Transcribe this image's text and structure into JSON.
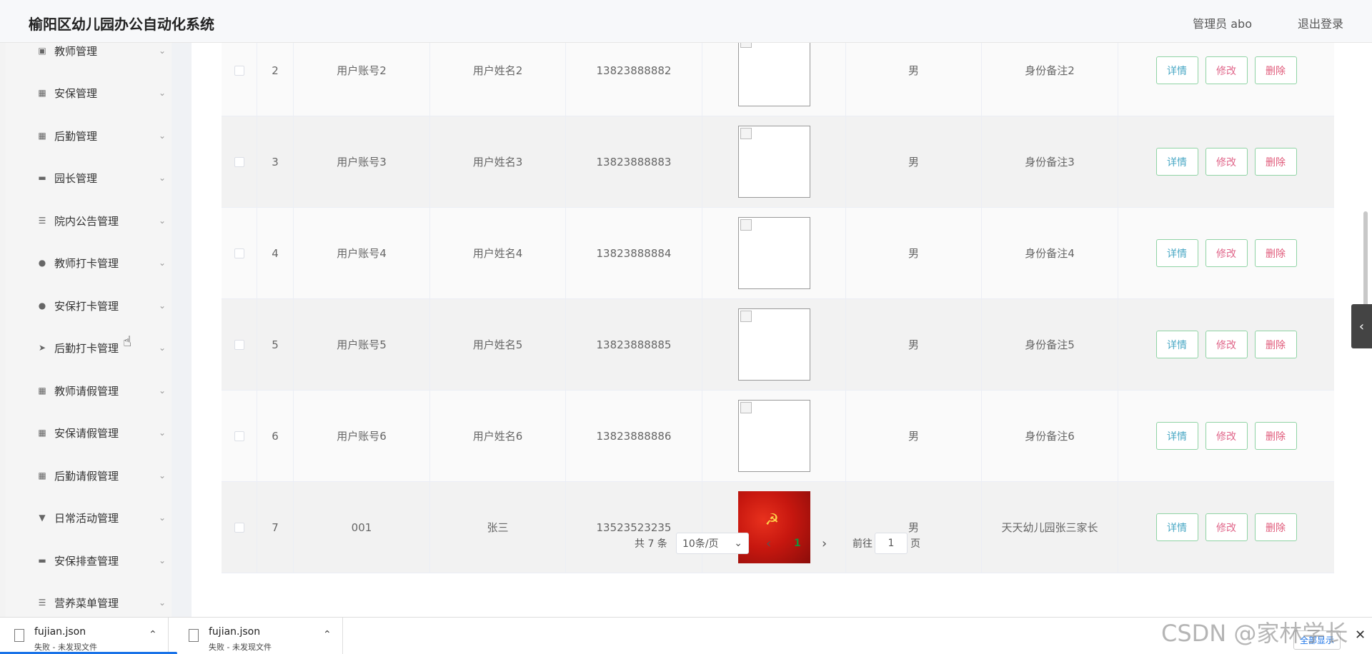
{
  "header": {
    "title": "榆阳区幼儿园办公自动化系统",
    "user": "管理员 abo",
    "logout": "退出登录"
  },
  "sidebar": {
    "items": [
      {
        "icon": "▣",
        "label": "教师管理",
        "chev": "⌄"
      },
      {
        "icon": "▦",
        "label": "安保管理",
        "chev": "⌄"
      },
      {
        "icon": "▦",
        "label": "后勤管理",
        "chev": "⌄"
      },
      {
        "icon": "▬",
        "label": "园长管理",
        "chev": "⌄"
      },
      {
        "icon": "☰",
        "label": "院内公告管理",
        "chev": "⌄"
      },
      {
        "icon": "●",
        "label": "教师打卡管理",
        "chev": "⌄"
      },
      {
        "icon": "●",
        "label": "安保打卡管理",
        "chev": "⌄"
      },
      {
        "icon": "➤",
        "label": "后勤打卡管理",
        "chev": "⌄"
      },
      {
        "icon": "▦",
        "label": "教师请假管理",
        "chev": "⌄"
      },
      {
        "icon": "▦",
        "label": "安保请假管理",
        "chev": "⌄"
      },
      {
        "icon": "▦",
        "label": "后勤请假管理",
        "chev": "⌄"
      },
      {
        "icon": "▼",
        "label": "日常活动管理",
        "chev": "⌄"
      },
      {
        "icon": "▬",
        "label": "安保排查管理",
        "chev": "⌄"
      },
      {
        "icon": "☰",
        "label": "营养菜单管理",
        "chev": "⌄"
      }
    ]
  },
  "table": {
    "rows": [
      {
        "index": "2",
        "account": "用户账号2",
        "name": "用户姓名2",
        "phone": "13823888882",
        "gender": "男",
        "note": "身份备注2"
      },
      {
        "index": "3",
        "account": "用户账号3",
        "name": "用户姓名3",
        "phone": "13823888883",
        "gender": "男",
        "note": "身份备注3"
      },
      {
        "index": "4",
        "account": "用户账号4",
        "name": "用户姓名4",
        "phone": "13823888884",
        "gender": "男",
        "note": "身份备注4"
      },
      {
        "index": "5",
        "account": "用户账号5",
        "name": "用户姓名5",
        "phone": "13823888885",
        "gender": "男",
        "note": "身份备注5"
      },
      {
        "index": "6",
        "account": "用户账号6",
        "name": "用户姓名6",
        "phone": "13823888886",
        "gender": "男",
        "note": "身份备注6"
      },
      {
        "index": "7",
        "account": "001",
        "name": "张三",
        "phone": "13523523235",
        "gender": "男",
        "note": "天天幼儿园张三家长"
      }
    ],
    "actions": {
      "detail": "详情",
      "edit": "修改",
      "delete": "删除"
    }
  },
  "pager": {
    "total": "共 7 条",
    "page_size": "10条/页",
    "size_caret": "⌄",
    "prev": "‹",
    "current": "1",
    "next": "›",
    "goto": "前往",
    "goto_value": "1",
    "page_unit": "页"
  },
  "side_toggle": "‹",
  "downloads": {
    "items": [
      {
        "name": "fujian.json",
        "status": "失败 - 未发现文件",
        "caret": "⌃"
      },
      {
        "name": "fujian.json",
        "status": "失败 - 未发现文件",
        "caret": "⌃"
      }
    ],
    "show_all": "全部显示",
    "close": "✕"
  },
  "watermark": "CSDN @家林学长"
}
